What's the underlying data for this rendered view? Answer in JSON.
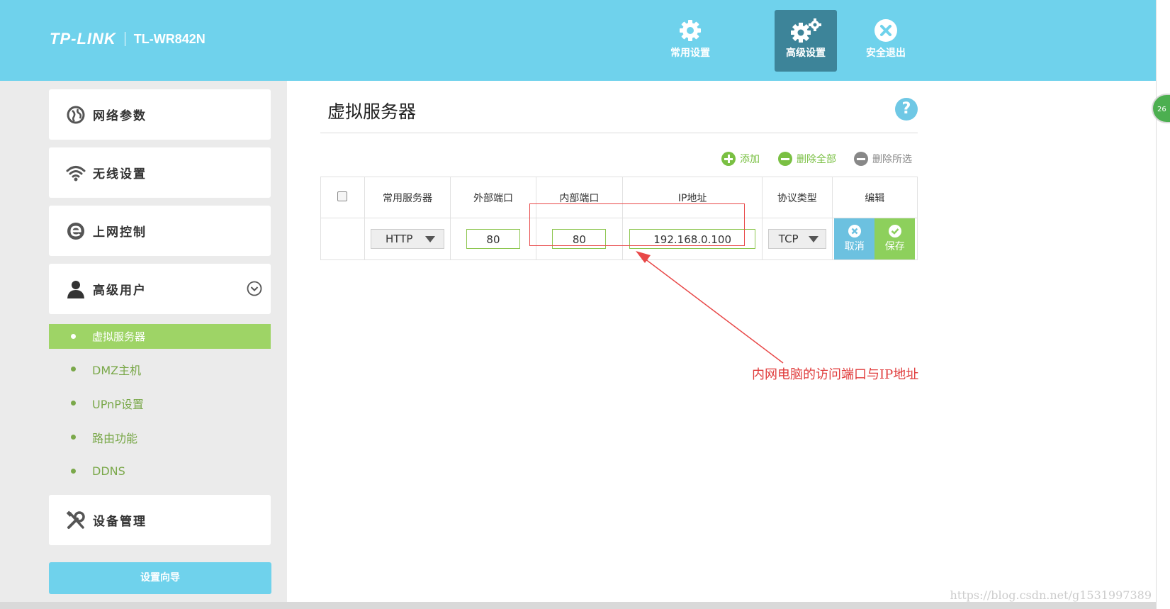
{
  "header": {
    "brand": "TP-LINK",
    "model": "TL-WR842N",
    "nav": [
      {
        "label": "常用设置",
        "icon": "gear-icon"
      },
      {
        "label": "高级设置",
        "icon": "gears-icon"
      },
      {
        "label": "安全退出",
        "icon": "exit-icon"
      }
    ],
    "float_badge": "26"
  },
  "sidebar": {
    "items": [
      {
        "label": "网络参数",
        "icon": "globe-icon"
      },
      {
        "label": "无线设置",
        "icon": "wifi-icon"
      },
      {
        "label": "上网控制",
        "icon": "browser-e-icon"
      },
      {
        "label": "高级用户",
        "icon": "user-icon"
      },
      {
        "label": "设备管理",
        "icon": "tools-icon"
      }
    ],
    "subitems": [
      "虚拟服务器",
      "DMZ主机",
      "UPnP设置",
      "路由功能",
      "DDNS"
    ],
    "wizard_label": "设置向导"
  },
  "main": {
    "title": "虚拟服务器",
    "help_label": "?",
    "toolbar": {
      "add": "添加",
      "delete_all": "删除全部",
      "delete_selected": "删除所选"
    },
    "table": {
      "headers": [
        "常用服务器",
        "外部端口",
        "内部端口",
        "IP地址",
        "协议类型",
        "编辑"
      ],
      "row": {
        "service": "HTTP",
        "external_port": "80",
        "internal_port": "80",
        "ip": "192.168.0.100",
        "protocol": "TCP",
        "cancel": "取消",
        "save": "保存"
      }
    },
    "annotation": "内网电脑的访问端口与IP地址"
  },
  "watermark": "https://blog.csdn.net/g1531997389",
  "colors": {
    "header": "#6fd2ec",
    "active_nav": "#3d8499",
    "green": "#9ed466",
    "annotation_red": "#e84848"
  }
}
